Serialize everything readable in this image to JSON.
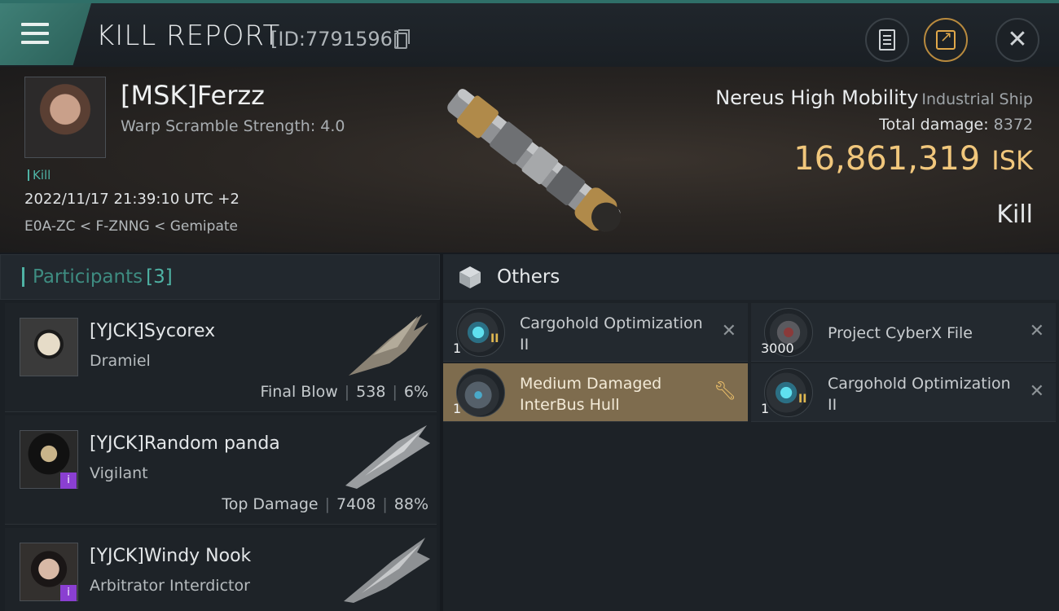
{
  "header": {
    "title": "KILL REPORT",
    "report_id": "[ID:7791596]"
  },
  "victim": {
    "name": "[MSK]Ferzz",
    "warp_scramble": "Warp Scramble Strength: 4.0",
    "tag": "Kill",
    "timestamp": "2022/11/17 21:39:10 UTC +2",
    "location": "E0A-ZC < F-ZNNG < Gemipate"
  },
  "ship": {
    "name": "Nereus High Mobility",
    "class": "Industrial Ship",
    "total_damage_label": "Total damage:",
    "total_damage": "8372",
    "isk_value": "16,861,319",
    "isk_unit": "ISK",
    "result": "Kill"
  },
  "participants": {
    "label": "Participants",
    "count": "[3]",
    "rows": [
      {
        "name": "[YJCK]Sycorex",
        "ship": "Dramiel",
        "role": "Final Blow",
        "damage": "538",
        "percent": "6%"
      },
      {
        "name": "[YJCK]Random panda",
        "ship": "Vigilant",
        "role": "Top Damage",
        "damage": "7408",
        "percent": "88%",
        "badge": "i"
      },
      {
        "name": "[YJCK]Windy Nook",
        "ship": "Arbitrator Interdictor",
        "badge": "i"
      }
    ]
  },
  "others": {
    "label": "Others",
    "items": [
      {
        "name": "Cargohold Optimization II",
        "qty": "1",
        "tier": "II",
        "action": "✕"
      },
      {
        "name": "Project CyberX File",
        "qty": "3000",
        "action": "✕"
      },
      {
        "name": "Medium Damaged InterBus Hull",
        "qty": "1",
        "action": "wrench"
      },
      {
        "name": "Cargohold Optimization II",
        "qty": "1",
        "tier": "II",
        "action": "✕"
      }
    ]
  },
  "colors": {
    "accent_teal": "#4fb3a5",
    "isk_gold": "#f1c77c",
    "highlight": "#7e6c4e",
    "badge_purple": "#8a3fd1"
  }
}
